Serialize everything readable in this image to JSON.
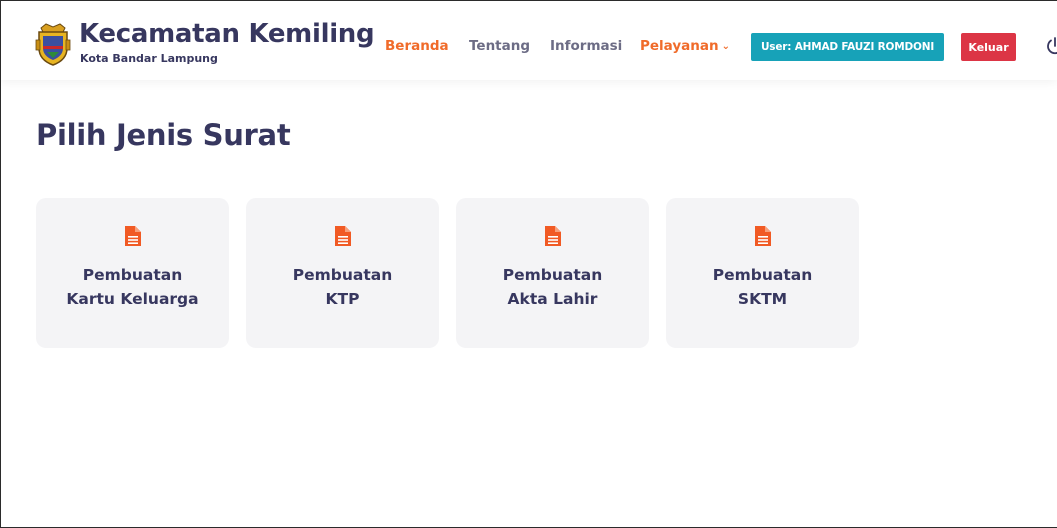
{
  "header": {
    "brand_title": "Kecamatan Kemiling",
    "brand_subtitle": "Kota Bandar Lampung",
    "nav": [
      {
        "label": "Beranda",
        "active": true
      },
      {
        "label": "Tentang"
      },
      {
        "label": "Informasi"
      },
      {
        "label": "Pelayanan",
        "dropdown": true,
        "active": true
      }
    ],
    "user_badge": "User: AHMAD FAUZI ROMDONI",
    "logout": "Keluar",
    "icons": {
      "logo": "crest-logo",
      "power": "power-icon"
    }
  },
  "main": {
    "title": "Pilih Jenis Surat",
    "cards": [
      {
        "line1": "Pembuatan",
        "line2": "Kartu Keluarga",
        "icon": "document-icon"
      },
      {
        "line1": "Pembuatan",
        "line2": "KTP",
        "icon": "document-icon"
      },
      {
        "line1": "Pembuatan",
        "line2": "Akta Lahir",
        "icon": "document-icon"
      },
      {
        "line1": "Pembuatan",
        "line2": "SKTM",
        "icon": "document-icon"
      }
    ]
  },
  "colors": {
    "accent": "#f06b2a",
    "text": "#37375f",
    "muted": "#6c6c85",
    "info": "#17a2b8",
    "danger": "#dc3545",
    "card_bg": "#f4f4f6"
  }
}
